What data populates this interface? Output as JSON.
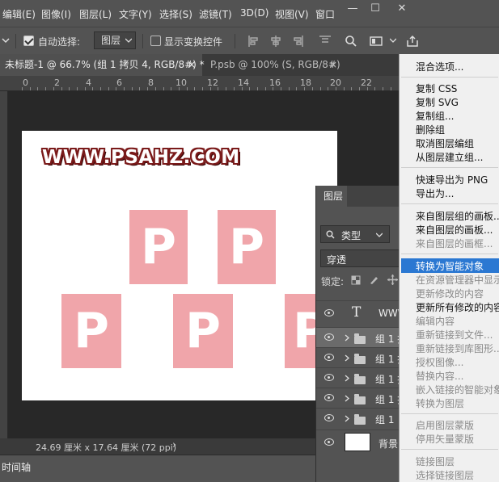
{
  "menubar": {
    "items": [
      "编辑(E)",
      "图像(I)",
      "图层(L)",
      "文字(Y)",
      "选择(S)",
      "滤镜(T)",
      "3D(D)",
      "视图(V)",
      "窗口"
    ],
    "window_controls": [
      "—",
      "☐",
      "✕"
    ]
  },
  "options": {
    "auto_select_label": "自动选择:",
    "auto_select_checked": true,
    "auto_select_target": "图层",
    "show_transform_label": "显示变换控件",
    "show_transform_checked": false
  },
  "tabs": [
    {
      "label": "未标题-1 @ 66.7% (组 1 拷贝 4, RGB/8#) *",
      "close": "×",
      "active": true
    },
    {
      "label": "P.psb @ 100% (S, RGB/8#)",
      "close": "×",
      "active": false
    }
  ],
  "ruler": {
    "numbers": [
      "0",
      "2",
      "4",
      "6",
      "8",
      "10",
      "12",
      "14",
      "16",
      "18",
      "20",
      "22"
    ]
  },
  "canvas": {
    "logo_text": "WWW.PSAHZ.COM",
    "tile_letter": "P",
    "tile_color": "#f0a5aa"
  },
  "status": {
    "doc_info": "24.69 厘米 x 17.64 厘米 (72 ppi)",
    "arrow": "›"
  },
  "timeline": {
    "label": "时间轴"
  },
  "layers_panel": {
    "tab_label": "图层",
    "filter_label": "类型",
    "blend_mode": "穿透",
    "lock_label": "锁定:",
    "layers": [
      {
        "type": "text",
        "name": "WWW",
        "glyph": "T",
        "selected": false
      },
      {
        "type": "group",
        "name": "组 1 拷",
        "selected": true
      },
      {
        "type": "group",
        "name": "组 1 拷",
        "selected": false
      },
      {
        "type": "group",
        "name": "组 1 拷",
        "selected": false
      },
      {
        "type": "group",
        "name": "组 1 拷",
        "selected": false
      },
      {
        "type": "group",
        "name": "组 1",
        "selected": false
      },
      {
        "type": "background",
        "name": "背景",
        "selected": false
      }
    ]
  },
  "context_menu": {
    "items": [
      {
        "label": "混合选项...",
        "enabled": true
      },
      {
        "label": "复制 CSS",
        "enabled": true
      },
      {
        "label": "复制 SVG",
        "enabled": true
      },
      {
        "label": "复制组...",
        "enabled": true
      },
      {
        "label": "删除组",
        "enabled": true
      },
      {
        "label": "取消图层编组",
        "enabled": true
      },
      {
        "label": "从图层建立组...",
        "enabled": true
      },
      {
        "label": "快速导出为 PNG",
        "enabled": true
      },
      {
        "label": "导出为...",
        "enabled": true
      },
      {
        "label": "来自图层组的画板...",
        "enabled": true
      },
      {
        "label": "来自图层的画板...",
        "enabled": true
      },
      {
        "label": "来自图层的画框...",
        "enabled": false
      },
      {
        "label": "转换为智能对象",
        "enabled": true,
        "highlighted": true
      },
      {
        "label": "在资源管理器中显示",
        "enabled": false
      },
      {
        "label": "更新修改的内容",
        "enabled": false
      },
      {
        "label": "更新所有修改的内容",
        "enabled": true
      },
      {
        "label": "编辑内容",
        "enabled": false
      },
      {
        "label": "重新链接到文件...",
        "enabled": false
      },
      {
        "label": "重新链接到库图形...",
        "enabled": false
      },
      {
        "label": "授权图像...",
        "enabled": false
      },
      {
        "label": "替换内容...",
        "enabled": false
      },
      {
        "label": "嵌入链接的智能对象",
        "enabled": false
      },
      {
        "label": "转换为图层",
        "enabled": false
      },
      {
        "label": "启用图层蒙版",
        "enabled": false
      },
      {
        "label": "停用矢量蒙版",
        "enabled": false
      },
      {
        "label": "链接图层",
        "enabled": false
      },
      {
        "label": "选择链接图层",
        "enabled": false
      }
    ]
  }
}
